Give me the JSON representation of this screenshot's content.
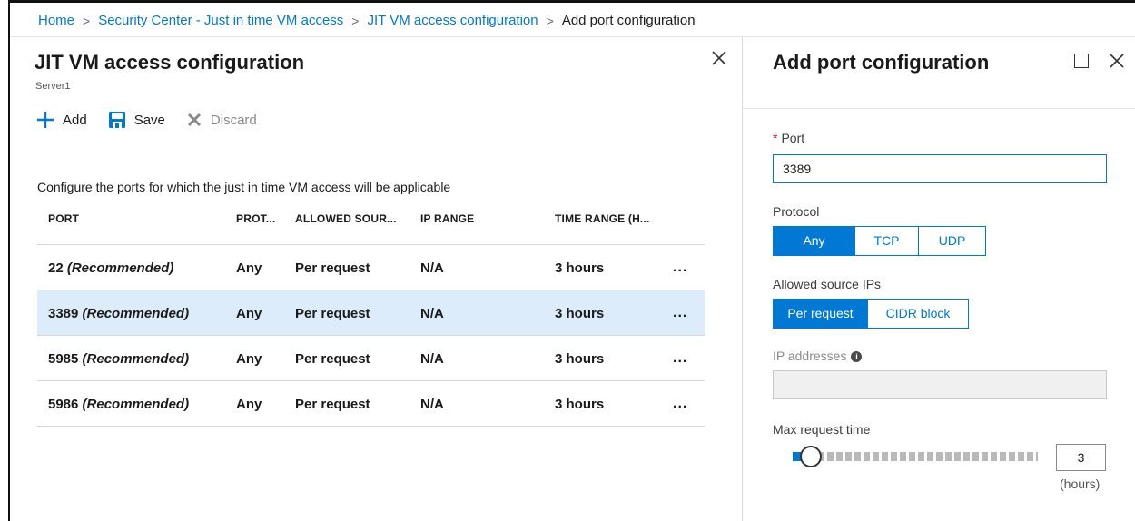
{
  "breadcrumb": {
    "home": "Home",
    "security_center": "Security Center - Just in time VM access",
    "jit_config": "JIT VM access configuration",
    "current": "Add port configuration",
    "separator": ">"
  },
  "left_blade": {
    "title": "JIT VM access configuration",
    "subtitle": "Server1",
    "toolbar": {
      "add_label": "Add",
      "save_label": "Save",
      "discard_label": "Discard"
    },
    "description": "Configure the ports for which the just in time VM access will be applicable",
    "columns": [
      "PORT",
      "PROT...",
      "ALLOWED SOUR...",
      "IP RANGE",
      "TIME RANGE (H..."
    ],
    "rows": [
      {
        "port": "22",
        "recommended": "(Recommended)",
        "protocol": "Any",
        "allowed_source": "Per request",
        "ip_range": "N/A",
        "time_range": "3 hours",
        "more": "...",
        "selected": false
      },
      {
        "port": "3389",
        "recommended": "(Recommended)",
        "protocol": "Any",
        "allowed_source": "Per request",
        "ip_range": "N/A",
        "time_range": "3 hours",
        "more": "...",
        "selected": true
      },
      {
        "port": "5985",
        "recommended": "(Recommended)",
        "protocol": "Any",
        "allowed_source": "Per request",
        "ip_range": "N/A",
        "time_range": "3 hours",
        "more": "...",
        "selected": false
      },
      {
        "port": "5986",
        "recommended": "(Recommended)",
        "protocol": "Any",
        "allowed_source": "Per request",
        "ip_range": "N/A",
        "time_range": "3 hours",
        "more": "...",
        "selected": false
      }
    ]
  },
  "right_blade": {
    "title": "Add port configuration",
    "port": {
      "required_mark": "*",
      "label": "Port",
      "value": "3389"
    },
    "protocol": {
      "label": "Protocol",
      "options": [
        "Any",
        "TCP",
        "UDP"
      ],
      "selected": "Any"
    },
    "allowed_source": {
      "label": "Allowed source IPs",
      "options": [
        "Per request",
        "CIDR block"
      ],
      "selected": "Per request"
    },
    "ip_addresses": {
      "label": "IP addresses",
      "info_icon": "i",
      "value": ""
    },
    "max_request_time": {
      "label": "Max request time",
      "value": "3",
      "unit": "(hours)",
      "slider_min": 1,
      "slider_max": 24,
      "slider_value": 3
    }
  },
  "colors": {
    "accent": "#0078d4",
    "selected_row": "#dcecfa",
    "required": "#c50f1f",
    "disabled_text": "#8a8a8a"
  },
  "icons": {
    "add": "plus-icon",
    "save": "save-icon",
    "discard": "x-icon",
    "close": "close-icon",
    "maximize": "maximize-icon",
    "info": "info-icon",
    "more": "ellipsis-icon"
  }
}
